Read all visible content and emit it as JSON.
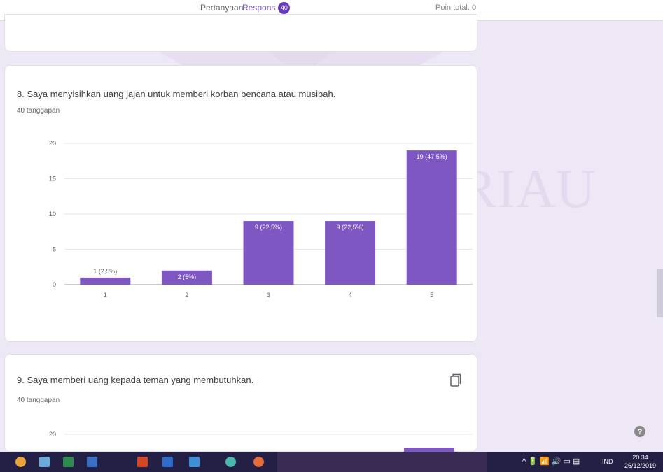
{
  "tabs": {
    "questions_label": "Pertanyaan",
    "responses_label": "Respons",
    "responses_count": "40"
  },
  "total_points": "Poin total: 0",
  "watermark": "UIN SUSKA RIAU",
  "question_8": {
    "title": "8. Saya menyisihkan uang jajan untuk memberi korban bencana atau musibah.",
    "response_count": "40 tanggapan"
  },
  "question_9": {
    "title": "9. Saya memberi uang kepada teman yang membutuhkan.",
    "response_count": "40 tanggapan",
    "y_tick_top": "20"
  },
  "chart_data": {
    "type": "bar",
    "categories": [
      "1",
      "2",
      "3",
      "4",
      "5"
    ],
    "values": [
      1,
      2,
      9,
      9,
      19
    ],
    "data_labels": [
      "1 (2,5%)",
      "2 (5%)",
      "9 (22,5%)",
      "9 (22,5%)",
      "19 (47,5%)"
    ],
    "yticks": [
      "0",
      "5",
      "10",
      "15",
      "20"
    ],
    "ylim": [
      0,
      20
    ],
    "grid": true,
    "bar_color": "#7e57c2"
  },
  "taskbar": {
    "tray_text": "^ 🔋 📶 🔊 ▭ ▤",
    "language": "IND",
    "time": "20.34",
    "date": "26/12/2019"
  },
  "colors": {
    "accent": "#673ab7",
    "background": "#ede7f6",
    "taskbar": "#241f45"
  }
}
